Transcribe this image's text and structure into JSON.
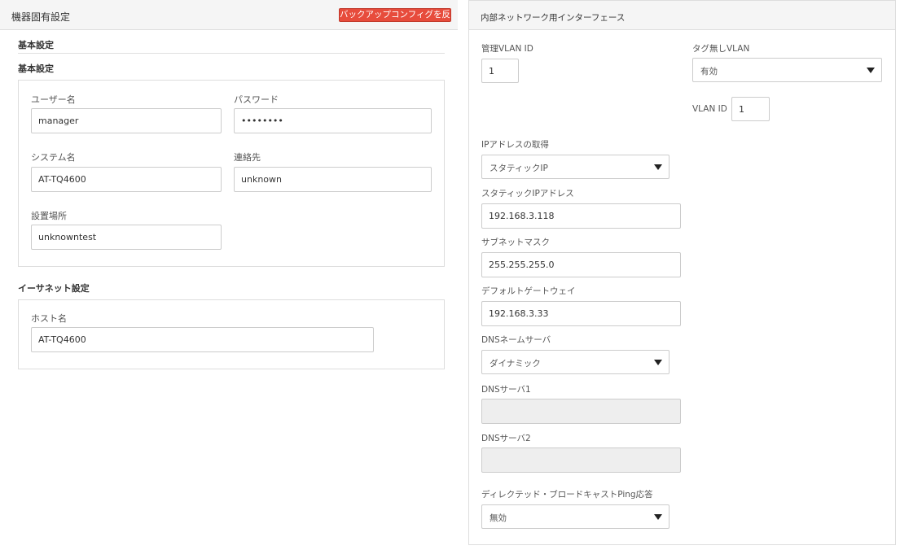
{
  "left": {
    "title": "機器固有設定",
    "backup_button": "バックアップコンフィグを反映",
    "basic_section_title": "基本設定",
    "basic_sub_title": "基本設定",
    "username": {
      "label": "ユーザー名",
      "value": "manager"
    },
    "password": {
      "label": "パスワード",
      "value": "••••••••"
    },
    "system_name": {
      "label": "システム名",
      "value": "AT-TQ4600"
    },
    "contact": {
      "label": "連絡先",
      "value": "unknown"
    },
    "location": {
      "label": "設置場所",
      "value": "unknowntest"
    },
    "ethernet_title": "イーサネット設定",
    "hostname": {
      "label": "ホスト名",
      "value": "AT-TQ4600"
    }
  },
  "right": {
    "title": "内部ネットワーク用インターフェース",
    "mgmt_vlan": {
      "label": "管理VLAN ID",
      "value": "1"
    },
    "untagged_vlan": {
      "label": "タグ無しVLAN",
      "selected": "有効"
    },
    "vlan_id": {
      "label": "VLAN ID",
      "value": "1"
    },
    "ip_acquire": {
      "label": "IPアドレスの取得",
      "selected": "スタティックIP"
    },
    "static_ip": {
      "label": "スタティックIPアドレス",
      "value": "192.168.3.118"
    },
    "subnet": {
      "label": "サブネットマスク",
      "value": "255.255.255.0"
    },
    "gateway": {
      "label": "デフォルトゲートウェイ",
      "value": "192.168.3.33"
    },
    "dns_mode": {
      "label": "DNSネームサーバ",
      "selected": "ダイナミック"
    },
    "dns1": {
      "label": "DNSサーバ1",
      "value": ""
    },
    "dns2": {
      "label": "DNSサーバ2",
      "value": ""
    },
    "directed_ping": {
      "label": "ディレクテッド・ブロードキャストPing応答",
      "selected": "無効"
    }
  },
  "colors": {
    "backup_button_bg": "#e74c3c",
    "header_bg": "#f5f5f5",
    "border": "#dddddd",
    "disabled_input_bg": "#eeeeee"
  },
  "icons": {
    "select_caret": "caret-down-icon"
  }
}
